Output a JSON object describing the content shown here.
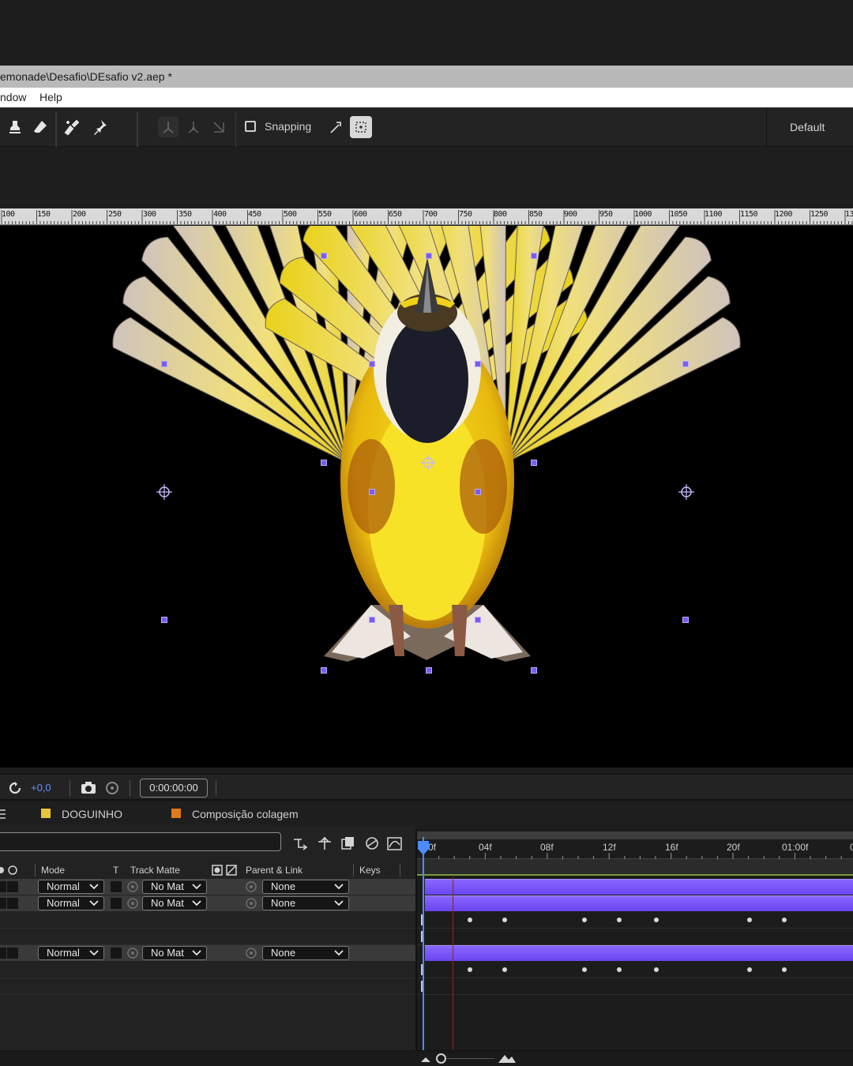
{
  "window": {
    "title": "emonade\\Desafio\\DEsafio v2.aep *"
  },
  "menu": {
    "items": [
      "ndow",
      "Help"
    ]
  },
  "toolbar": {
    "tools": [
      "stamp-tool-icon",
      "eraser-tool-icon",
      "roto-brush-icon",
      "puppet-pin-icon"
    ],
    "axis_tools": [
      "local-axis-icon",
      "world-axis-icon",
      "view-axis-icon"
    ],
    "snapping_label": "Snapping",
    "snapping_checked": false,
    "workspace_label": "Default"
  },
  "ruler": {
    "labels": [
      "100",
      "150",
      "200",
      "250",
      "300",
      "350",
      "400",
      "450",
      "500",
      "550",
      "600",
      "650",
      "700",
      "750",
      "800",
      "850",
      "900",
      "950",
      "1000",
      "1050",
      "1100",
      "1150",
      "1200",
      "1250",
      "13"
    ]
  },
  "viewer_footer": {
    "exposure_value": "+0,0",
    "timecode": "0:00:00:00"
  },
  "timeline": {
    "tabs": [
      {
        "label": "DOGUINHO",
        "color": "#e8c43a"
      },
      {
        "label": "Composição colagem",
        "color": "#e07b17"
      }
    ],
    "columns": {
      "mode": "Mode",
      "t": "T",
      "track_matte": "Track Matte",
      "parent": "Parent & Link",
      "keys": "Keys"
    },
    "ruler_labels": [
      "0f",
      "04f",
      "08f",
      "12f",
      "16f",
      "20f",
      "01:00f"
    ],
    "layers": [
      {
        "mode": "Normal",
        "matte": "No Mat",
        "parent": "None"
      },
      {
        "mode": "Normal",
        "matte": "No Mat",
        "parent": "None"
      },
      {
        "mode": "Normal",
        "matte": "No Mat",
        "parent": "None"
      }
    ]
  },
  "colors": {
    "layer_bar": "#7a55f5",
    "handle": "#7b5cf0",
    "playhead": "#4a8cff"
  }
}
